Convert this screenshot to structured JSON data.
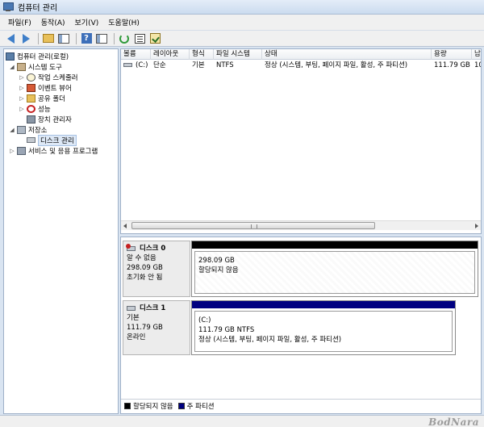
{
  "window": {
    "title": "컴퓨터 관리"
  },
  "menu": [
    "파일(F)",
    "동작(A)",
    "보기(V)",
    "도움말(H)"
  ],
  "toolbar": {
    "icons": [
      "back-icon",
      "forward-icon",
      "up-folder-icon",
      "console-tree-icon",
      "help-icon",
      "console-tree-toggle-icon",
      "refresh-icon",
      "properties-icon",
      "check-icon"
    ]
  },
  "tree": {
    "root": "컴퓨터 관리(로컬)",
    "system_tools": "시스템 도구",
    "task_scheduler": "작업 스케줄러",
    "event_viewer": "이벤트 뷰어",
    "shared_folders": "공유 폴더",
    "performance": "성능",
    "device_manager": "장치 관리자",
    "storage": "저장소",
    "disk_management": "디스크 관리",
    "services_apps": "서비스 및 응용 프로그램"
  },
  "volume_list": {
    "columns": [
      "볼륨",
      "레이아웃",
      "형식",
      "파일 시스템",
      "상태",
      "용량",
      "남"
    ],
    "rows": [
      {
        "volume": "(C:)",
        "layout": "단순",
        "type": "기본",
        "fs": "NTFS",
        "status": "정상 (시스템, 부팅, 페이지 파일, 활성, 주 파티션)",
        "capacity": "111.79 GB",
        "free": "10"
      }
    ],
    "scroll_grip": "III"
  },
  "disks": [
    {
      "name": "디스크 0",
      "type": "알 수 없음",
      "size": "298.09 GB",
      "state": "초기화 안 됨",
      "partition": {
        "size": "298.09 GB",
        "status": "할당되지 않음",
        "bar_color": "#000000"
      }
    },
    {
      "name": "디스크 1",
      "type": "기본",
      "size": "111.79 GB",
      "state": "온라인",
      "partition": {
        "label": "(C:)",
        "size_fs": "111.79 GB NTFS",
        "status": "정상 (시스템, 부팅, 페이지 파일, 활성, 주 파티션)",
        "bar_color": "#000080"
      }
    }
  ],
  "legend": [
    {
      "label": "할당되지 않음",
      "color": "#000000"
    },
    {
      "label": "주 파티션",
      "color": "#000080"
    }
  ],
  "watermark": "BodNara"
}
